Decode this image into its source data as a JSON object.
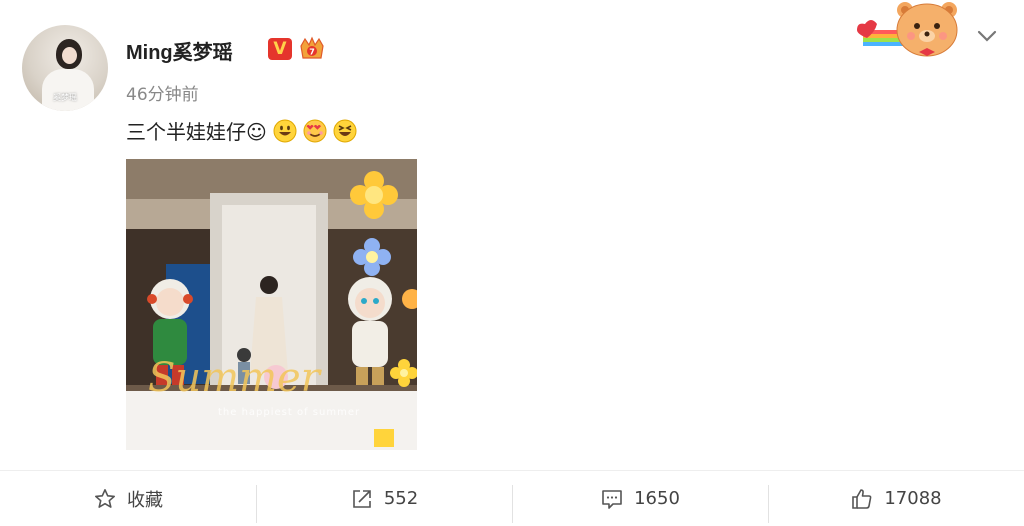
{
  "post": {
    "author": "Ming奚梦瑶",
    "avatar_caption": "奚梦瑶",
    "time": "46分钟前",
    "text": "三个半娃娃仔☺",
    "emojis": [
      "grinning-emoji",
      "love-face-emoji",
      "laughing-emoji"
    ],
    "verified_badge": "V",
    "image": {
      "overlay_text": "Summer",
      "overlay_subtext": "the happiest of summer"
    }
  },
  "actions": {
    "favorite_label": "收藏",
    "repost_count": "552",
    "comment_count": "1650",
    "like_count": "17088"
  },
  "colors": {
    "badge_red": "#e5352c",
    "badge_yellow": "#ffd24a",
    "text_gray": "#888888"
  }
}
